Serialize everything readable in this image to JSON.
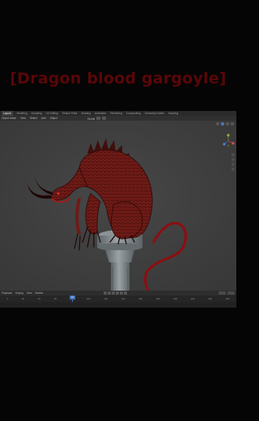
{
  "overlay": {
    "title": "[Dragon blood gargoyle]"
  },
  "workspace_tabs": [
    "Layout",
    "Modeling",
    "Sculpting",
    "UV Editing",
    "Texture Paint",
    "Shading",
    "Animation",
    "Rendering",
    "Compositing",
    "Geometry Nodes",
    "Scripting"
  ],
  "active_workspace_index": 0,
  "viewport_header": {
    "menus": [
      "Object Mode",
      "View",
      "Select",
      "Add",
      "Object"
    ],
    "transform": "Global"
  },
  "timeline": {
    "menus": [
      "Playback",
      "Keying",
      "View",
      "Marker"
    ],
    "current_frame": "10",
    "ruler": [
      "0",
      "20",
      "40",
      "60",
      "80",
      "100",
      "120",
      "140",
      "160",
      "180",
      "200",
      "220",
      "240",
      "260"
    ]
  },
  "colors": {
    "accent": "#4772b3",
    "title": "#5a0608",
    "creature": "#6e1b17",
    "tail": "#8a0f12",
    "pedestal": "#7c8488"
  }
}
